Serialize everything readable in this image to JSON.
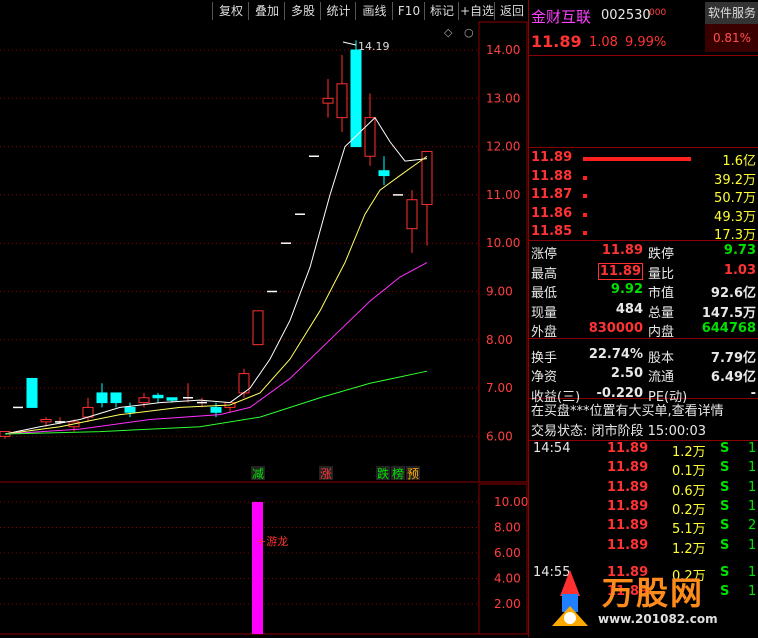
{
  "toolbar": {
    "buttons": [
      "复权",
      "叠加",
      "多股",
      "统计",
      "画线",
      "F10",
      "标记",
      "+自选",
      "返回"
    ]
  },
  "stock": {
    "name": "金财互联",
    "code": "002530",
    "code_suffix": "000",
    "price": "11.89",
    "change": "1.08",
    "change_pct": "9.99%",
    "sector": "软件服务",
    "sector_pct": "0.81%"
  },
  "order_book": [
    {
      "price": "11.89",
      "vol": "1.6亿"
    },
    {
      "price": "11.88",
      "vol": "39.2万"
    },
    {
      "price": "11.87",
      "vol": "50.7万"
    },
    {
      "price": "11.86",
      "vol": "49.3万"
    },
    {
      "price": "11.85",
      "vol": "17.3万"
    }
  ],
  "quote": {
    "limit_up_label": "涨停",
    "limit_up": "11.89",
    "limit_down_label": "跌停",
    "limit_down": "9.73",
    "high_label": "最高",
    "high": "11.89",
    "vol_ratio_label": "量比",
    "vol_ratio": "1.03",
    "low_label": "最低",
    "low": "9.92",
    "mkt_cap_label": "市值",
    "mkt_cap": "92.6亿",
    "cur_vol_label": "现量",
    "cur_vol": "484",
    "total_vol_label": "总量",
    "total_vol": "147.5万",
    "outer_label": "外盘",
    "outer": "830000",
    "inner_label": "内盘",
    "inner": "644768",
    "turnover_label": "换手",
    "turnover": "22.74%",
    "equity_label": "股本",
    "equity": "7.79亿",
    "nav_label": "净资",
    "nav": "2.50",
    "float_label": "流通",
    "float": "6.49亿",
    "eps_label": "收益(三)",
    "eps": "-0.220",
    "pe_label": "PE(动)",
    "pe": "-"
  },
  "notice": "在买盘***位置有大买单,查看详情",
  "status": "交易状态: 闭市阶段 15:00:03",
  "ticks": [
    {
      "time": "14:54",
      "price": "11.89",
      "vol": "1.2万",
      "side": "S",
      "n": "1"
    },
    {
      "time": "",
      "price": "11.89",
      "vol": "0.1万",
      "side": "S",
      "n": "1"
    },
    {
      "time": "",
      "price": "11.89",
      "vol": "0.6万",
      "side": "S",
      "n": "1"
    },
    {
      "time": "",
      "price": "11.89",
      "vol": "0.2万",
      "side": "S",
      "n": "1"
    },
    {
      "time": "",
      "price": "11.89",
      "vol": "5.1万",
      "side": "S",
      "n": "2"
    },
    {
      "time": "",
      "price": "11.89",
      "vol": "1.2万",
      "side": "S",
      "n": "1"
    },
    {
      "time": "14:55",
      "price": "11.89",
      "vol": "0.2万",
      "side": "S",
      "n": "1"
    },
    {
      "time": "",
      "price": "11.89",
      "vol": "",
      "side": "S",
      "n": "1"
    }
  ],
  "chart": {
    "price_axis": [
      "14.00",
      "13.00",
      "12.00",
      "11.00",
      "10.00",
      "9.00",
      "8.00",
      "7.00",
      "6.00"
    ],
    "vol_axis": [
      "10.00",
      "8.00",
      "6.00",
      "4.00",
      "2.00"
    ],
    "high_annotation": "14.19",
    "markers": [
      {
        "label": "减",
        "color": "#00e000"
      },
      {
        "label": "涨",
        "color": "#ff3333"
      },
      {
        "label": "跌",
        "color": "#00e000"
      },
      {
        "label": "榜",
        "color": "#00e000"
      },
      {
        "label": "预",
        "color": "#ffaa00"
      }
    ],
    "vol_label": "游龙",
    "colors": {
      "up": "#ff3030",
      "down": "#00ffff",
      "ma1": "#ffffff",
      "ma2": "#ffff60",
      "ma3": "#ff30ff",
      "ma4": "#30ff30",
      "grid": "#8b0000"
    }
  },
  "watermark": {
    "text": "万股网",
    "url": "www.201082.com"
  }
}
